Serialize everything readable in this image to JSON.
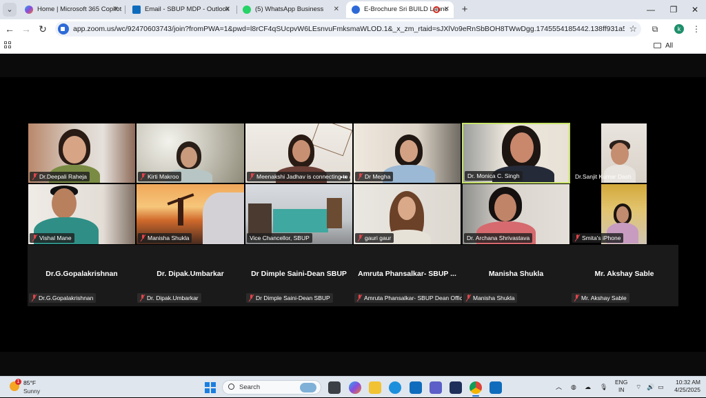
{
  "browser": {
    "tabs": [
      {
        "label": "Home | Microsoft 365 Copilot",
        "icon": "copilot-icon",
        "active": false
      },
      {
        "label": "Email - SBUP MDP - Outlook",
        "icon": "outlook-icon",
        "active": false
      },
      {
        "label": "(5) WhatsApp Business",
        "icon": "whatsapp-icon",
        "active": false
      },
      {
        "label": "E-Brochure Sri BUILD Launc",
        "icon": "zoom-icon",
        "active": true
      }
    ],
    "url": "app.zoom.us/wc/92470603743/join?fromPWA=1&pwd=l8rCF4qSUcpvW6LEsnvuFmksmaWLOD.1&_x_zm_rtaid=sJXlVo9eRnSbBOH8TWwDgg.1745554185442.138ff931a580f9635bfab27768d7a2...",
    "profile_initial": "k",
    "bookmarks_label": "All Bookmarks"
  },
  "participants_video": [
    {
      "name": "Dr.Deepali Raheja"
    },
    {
      "name": "Kirti Makroo"
    },
    {
      "name": "Meenakshi Jadhav is connecting to a..."
    },
    {
      "name": "Dr Megha"
    },
    {
      "name": "Dr. Monica C. Singh"
    },
    {
      "name": "Dr.Sanjit Kumar Dash"
    },
    {
      "name": "Vishal Mane"
    },
    {
      "name": "Manisha Shukla"
    },
    {
      "name": "Vice Chancellor, SBUP"
    },
    {
      "name": "gauri gaur"
    },
    {
      "name": "Dr. Archana Shrivastava"
    },
    {
      "name": "Smita's iPhone"
    }
  ],
  "participants_no_video": [
    {
      "display": "Dr.G.Gopalakrishnan",
      "label": "Dr.G.Gopalakrishnan"
    },
    {
      "display": "Dr. Dipak.Umbarkar",
      "label": "Dr. Dipak.Umbarkar"
    },
    {
      "display": "Dr Dimple Saini-Dean SBUP",
      "label": "Dr Dimple Saini-Dean SBUP"
    },
    {
      "display": "Amruta Phansalkar- SBUP ...",
      "label": "Amruta Phansalkar- SBUP Dean Office"
    },
    {
      "display": "Manisha Shukla",
      "label": "Manisha Shukla"
    },
    {
      "display": "Mr. Akshay Sable",
      "label": "Mr. Akshay Sable"
    }
  ],
  "taskbar": {
    "weather_temp": "85°F",
    "weather_cond": "Sunny",
    "weather_badge": "1",
    "search_label": "Search",
    "lang_1": "ENG",
    "lang_2": "IN",
    "time": "10:32 AM",
    "date": "4/25/2025"
  },
  "colors": {
    "zoom_blue": "#2d6ad8",
    "muted_red": "#e0454a",
    "active_tile_border": "#c7e36a"
  }
}
